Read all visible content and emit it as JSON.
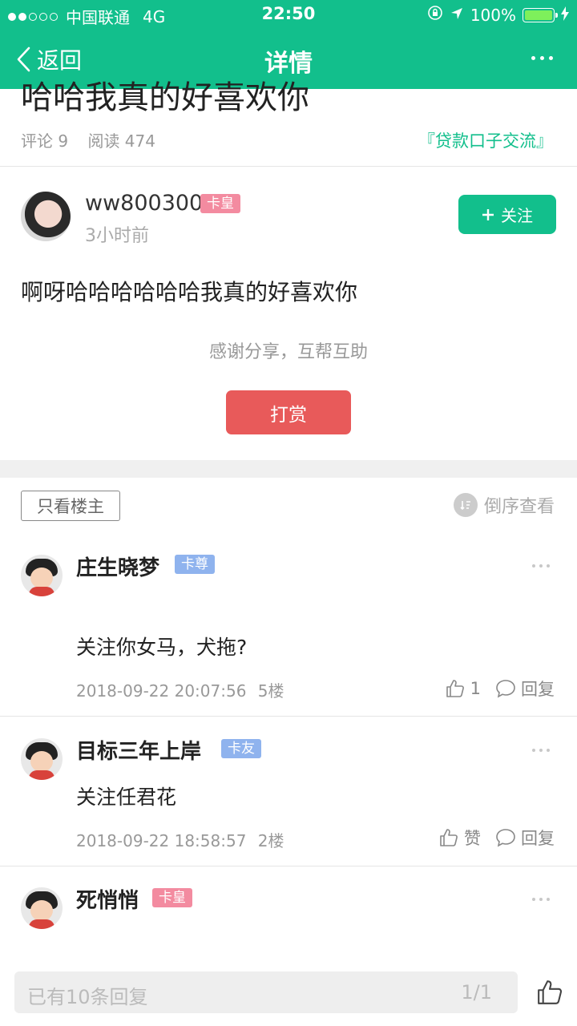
{
  "status_bar": {
    "carrier": "中国联通",
    "network": "4G",
    "time": "22:50",
    "battery": "100%"
  },
  "nav": {
    "back_label": "返回",
    "title": "详情"
  },
  "post": {
    "title": "哈哈我真的好喜欢你",
    "comments_label": "评论 9",
    "reads_label": "阅读 474",
    "board_tag": "『贷款口子交流』",
    "author": {
      "name": "ww800300",
      "badge": "卡皇",
      "time": "3小时前"
    },
    "follow_label": "关注",
    "body": "啊呀哈哈哈哈哈哈我真的好喜欢你",
    "thanks": "感谢分享，互帮互助",
    "reward_label": "打赏"
  },
  "filters": {
    "only_owner": "只看楼主",
    "reverse": "倒序查看"
  },
  "comments": [
    {
      "name": "庄生晓梦",
      "badge": "卡尊",
      "text": "关注你女马，犬拖?",
      "datetime": "2018-09-22 20:07:56",
      "floor": "5楼",
      "likes": "1",
      "reply": "回复"
    },
    {
      "name": "目标三年上岸",
      "badge": "卡友",
      "text": "关注任君花",
      "datetime": "2018-09-22 18:58:57",
      "floor": "2楼",
      "likes": "赞",
      "reply": "回复"
    },
    {
      "name": "死悄悄",
      "badge": "卡皇"
    }
  ],
  "bottom": {
    "placeholder": "已有10条回复",
    "page": "1/1"
  },
  "colors": {
    "brand_green": "#12bf8c",
    "reward_red": "#e85a5a",
    "badge_pink": "#f38ba0",
    "badge_blue": "#8fb3ee"
  }
}
